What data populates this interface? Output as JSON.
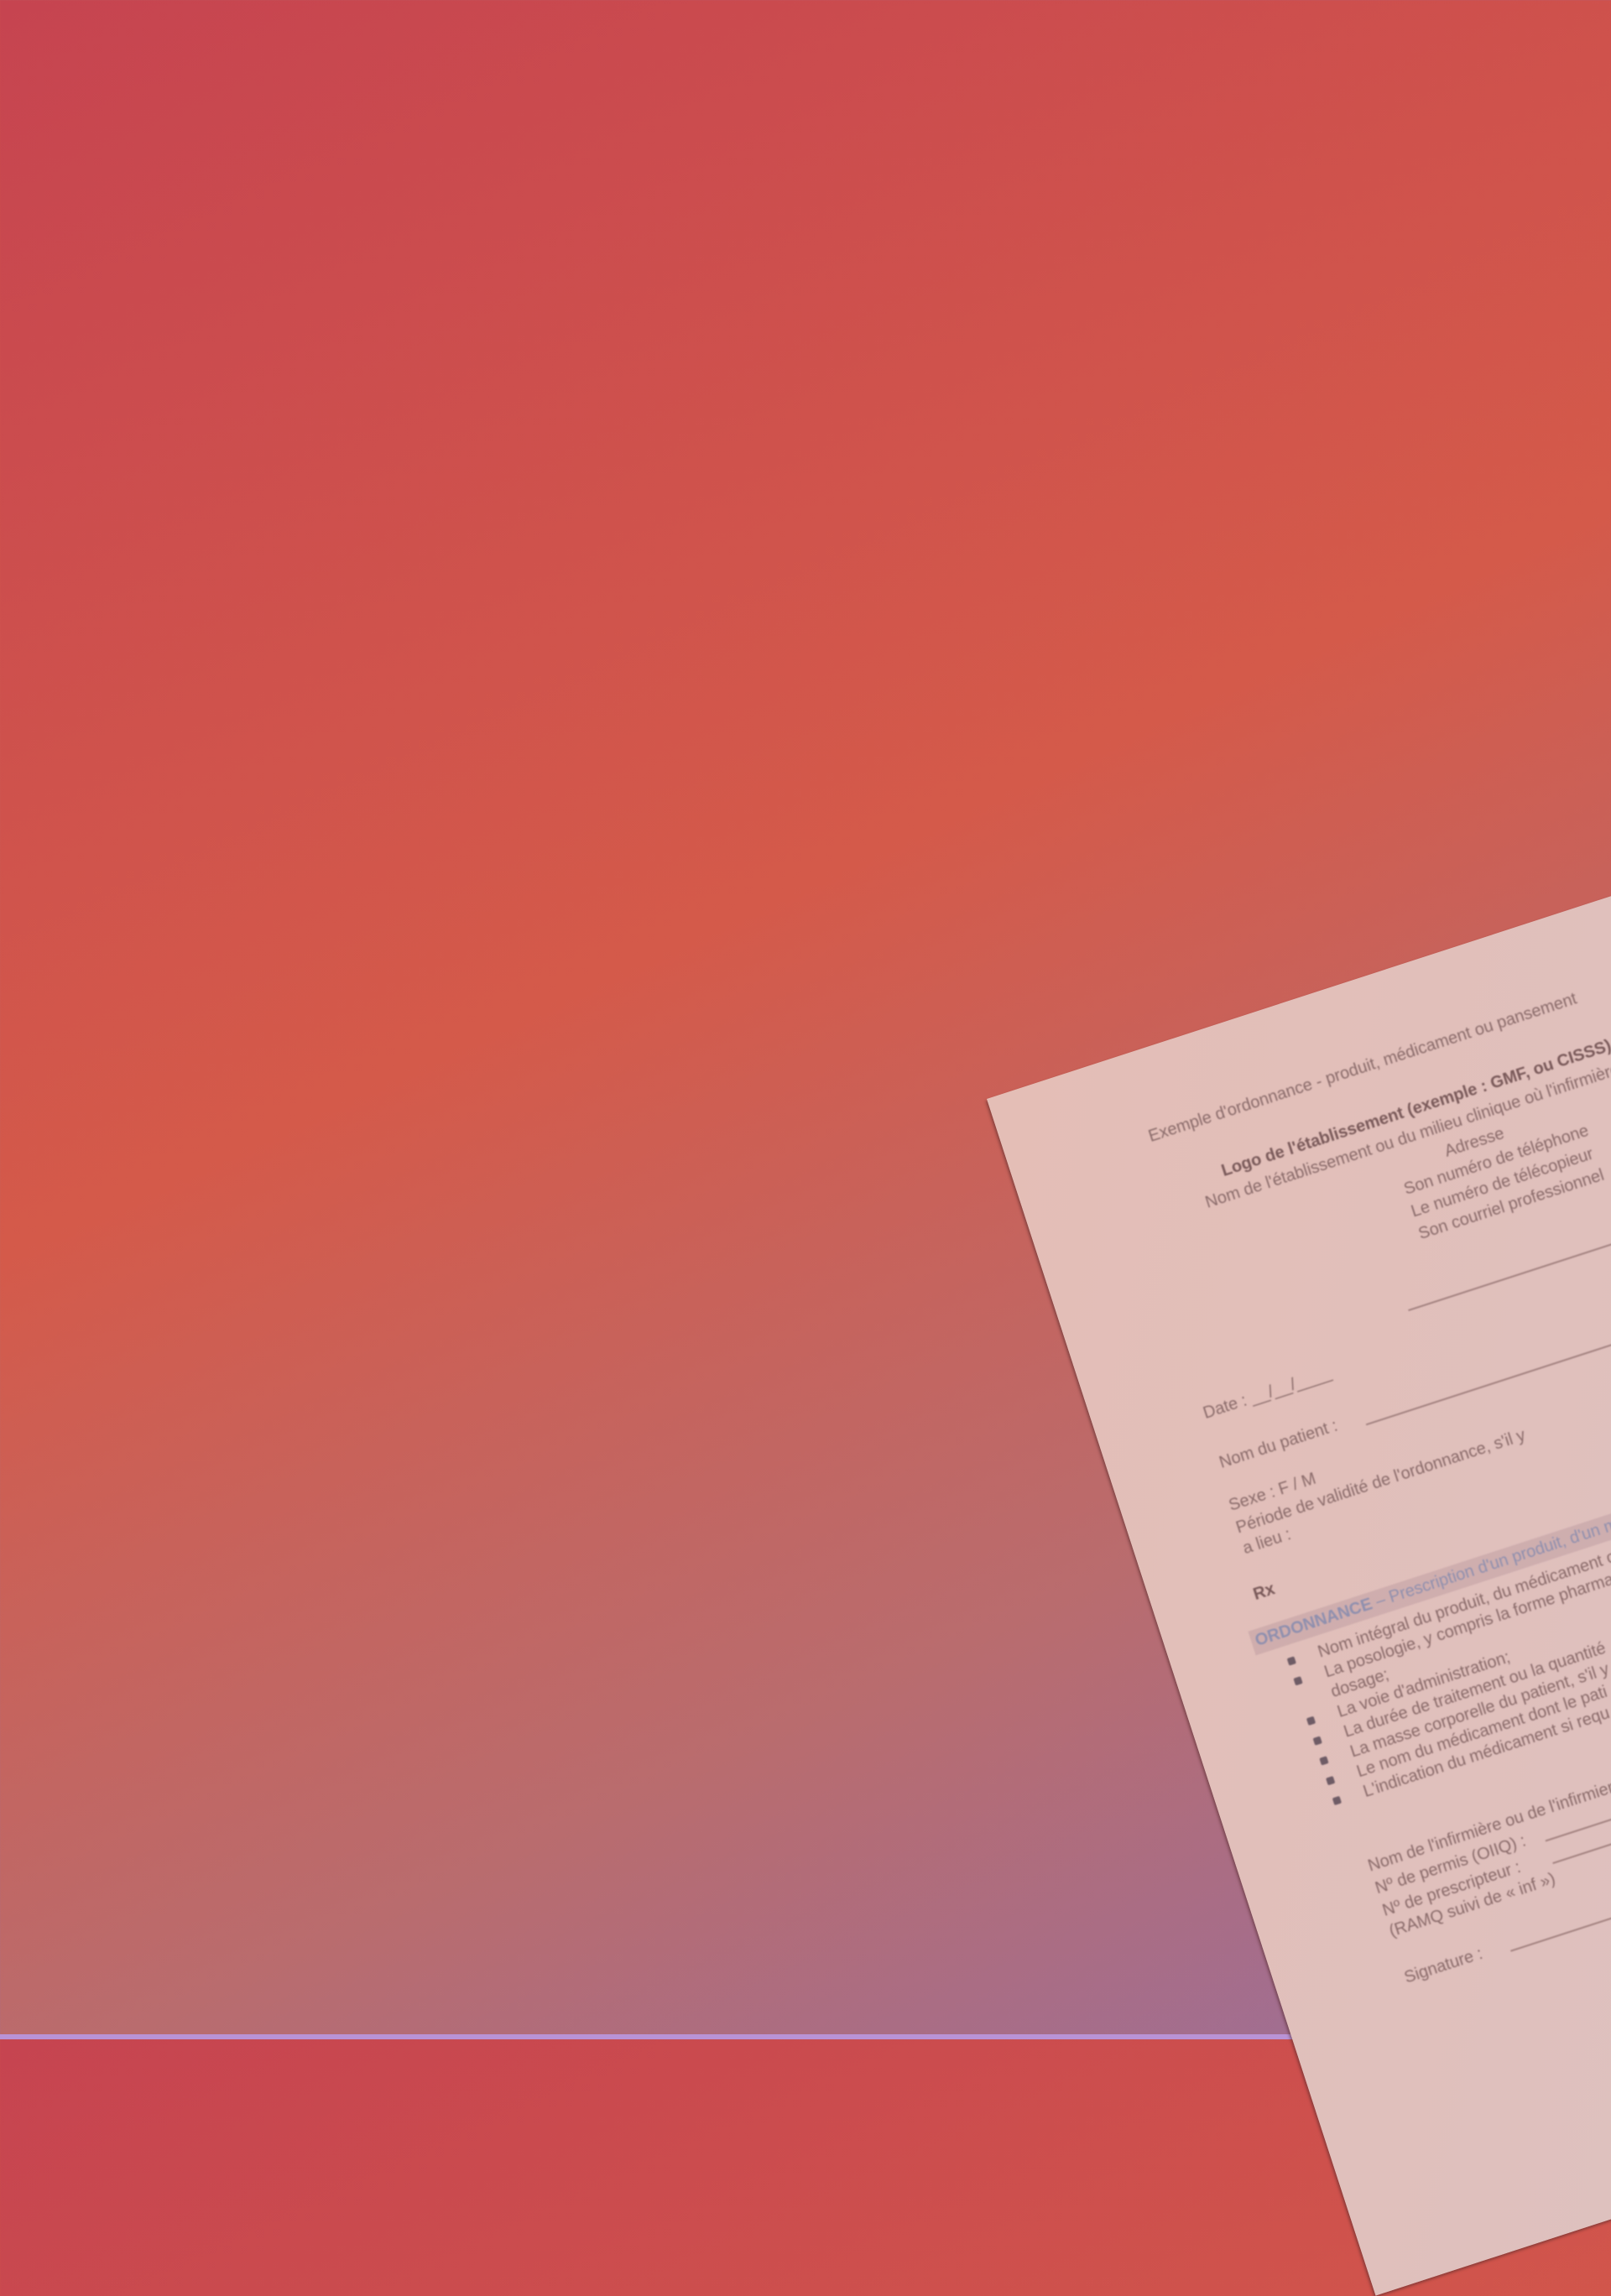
{
  "document": {
    "heading": "Exemple d'ordonnance - produit, médicament ou pansement",
    "logo_line": "Logo de l'établissement (exemple : GMF, ou CISSS)",
    "establishment_name": "Nom de l'établissement ou du milieu clinique où l'infirmière ou",
    "contact": {
      "address": "Adresse",
      "phone": "Son numéro de téléphone",
      "fax": "Le numéro de télécopieur",
      "email": "Son courriel professionnel"
    },
    "date_label": "Date : __/__/____",
    "patient_name_label": "Nom du patient :",
    "sex_label": "Sexe :  F  /  M",
    "validity_label": "Période de validité de l'ordonnance, s'il y",
    "validity_label_cont": "a lieu :",
    "rx_label": "Rx",
    "ordonnance_label": "ORDONNANCE",
    "ordonnance_title": "– Prescription d'un produit, d'un m",
    "items": [
      "Nom intégral du produit, du médicament ou",
      "La posologie, y compris la forme pharma",
      "dosage;",
      "La voie d'administration;",
      "La durée de traitement ou la quantité",
      "La masse corporelle du patient, s'il y",
      "Le nom du médicament dont le pati",
      "L'indication du médicament si requ"
    ],
    "nurse_name_label": "Nom de l'infirmière ou de l'infirmier :",
    "permit_label": "Nº de permis (OIIQ) :",
    "prescriber_label": "Nº de prescripteur :",
    "prescriber_note": "(RAMQ suivi de « inf »)",
    "signature_label": "Signature :"
  }
}
